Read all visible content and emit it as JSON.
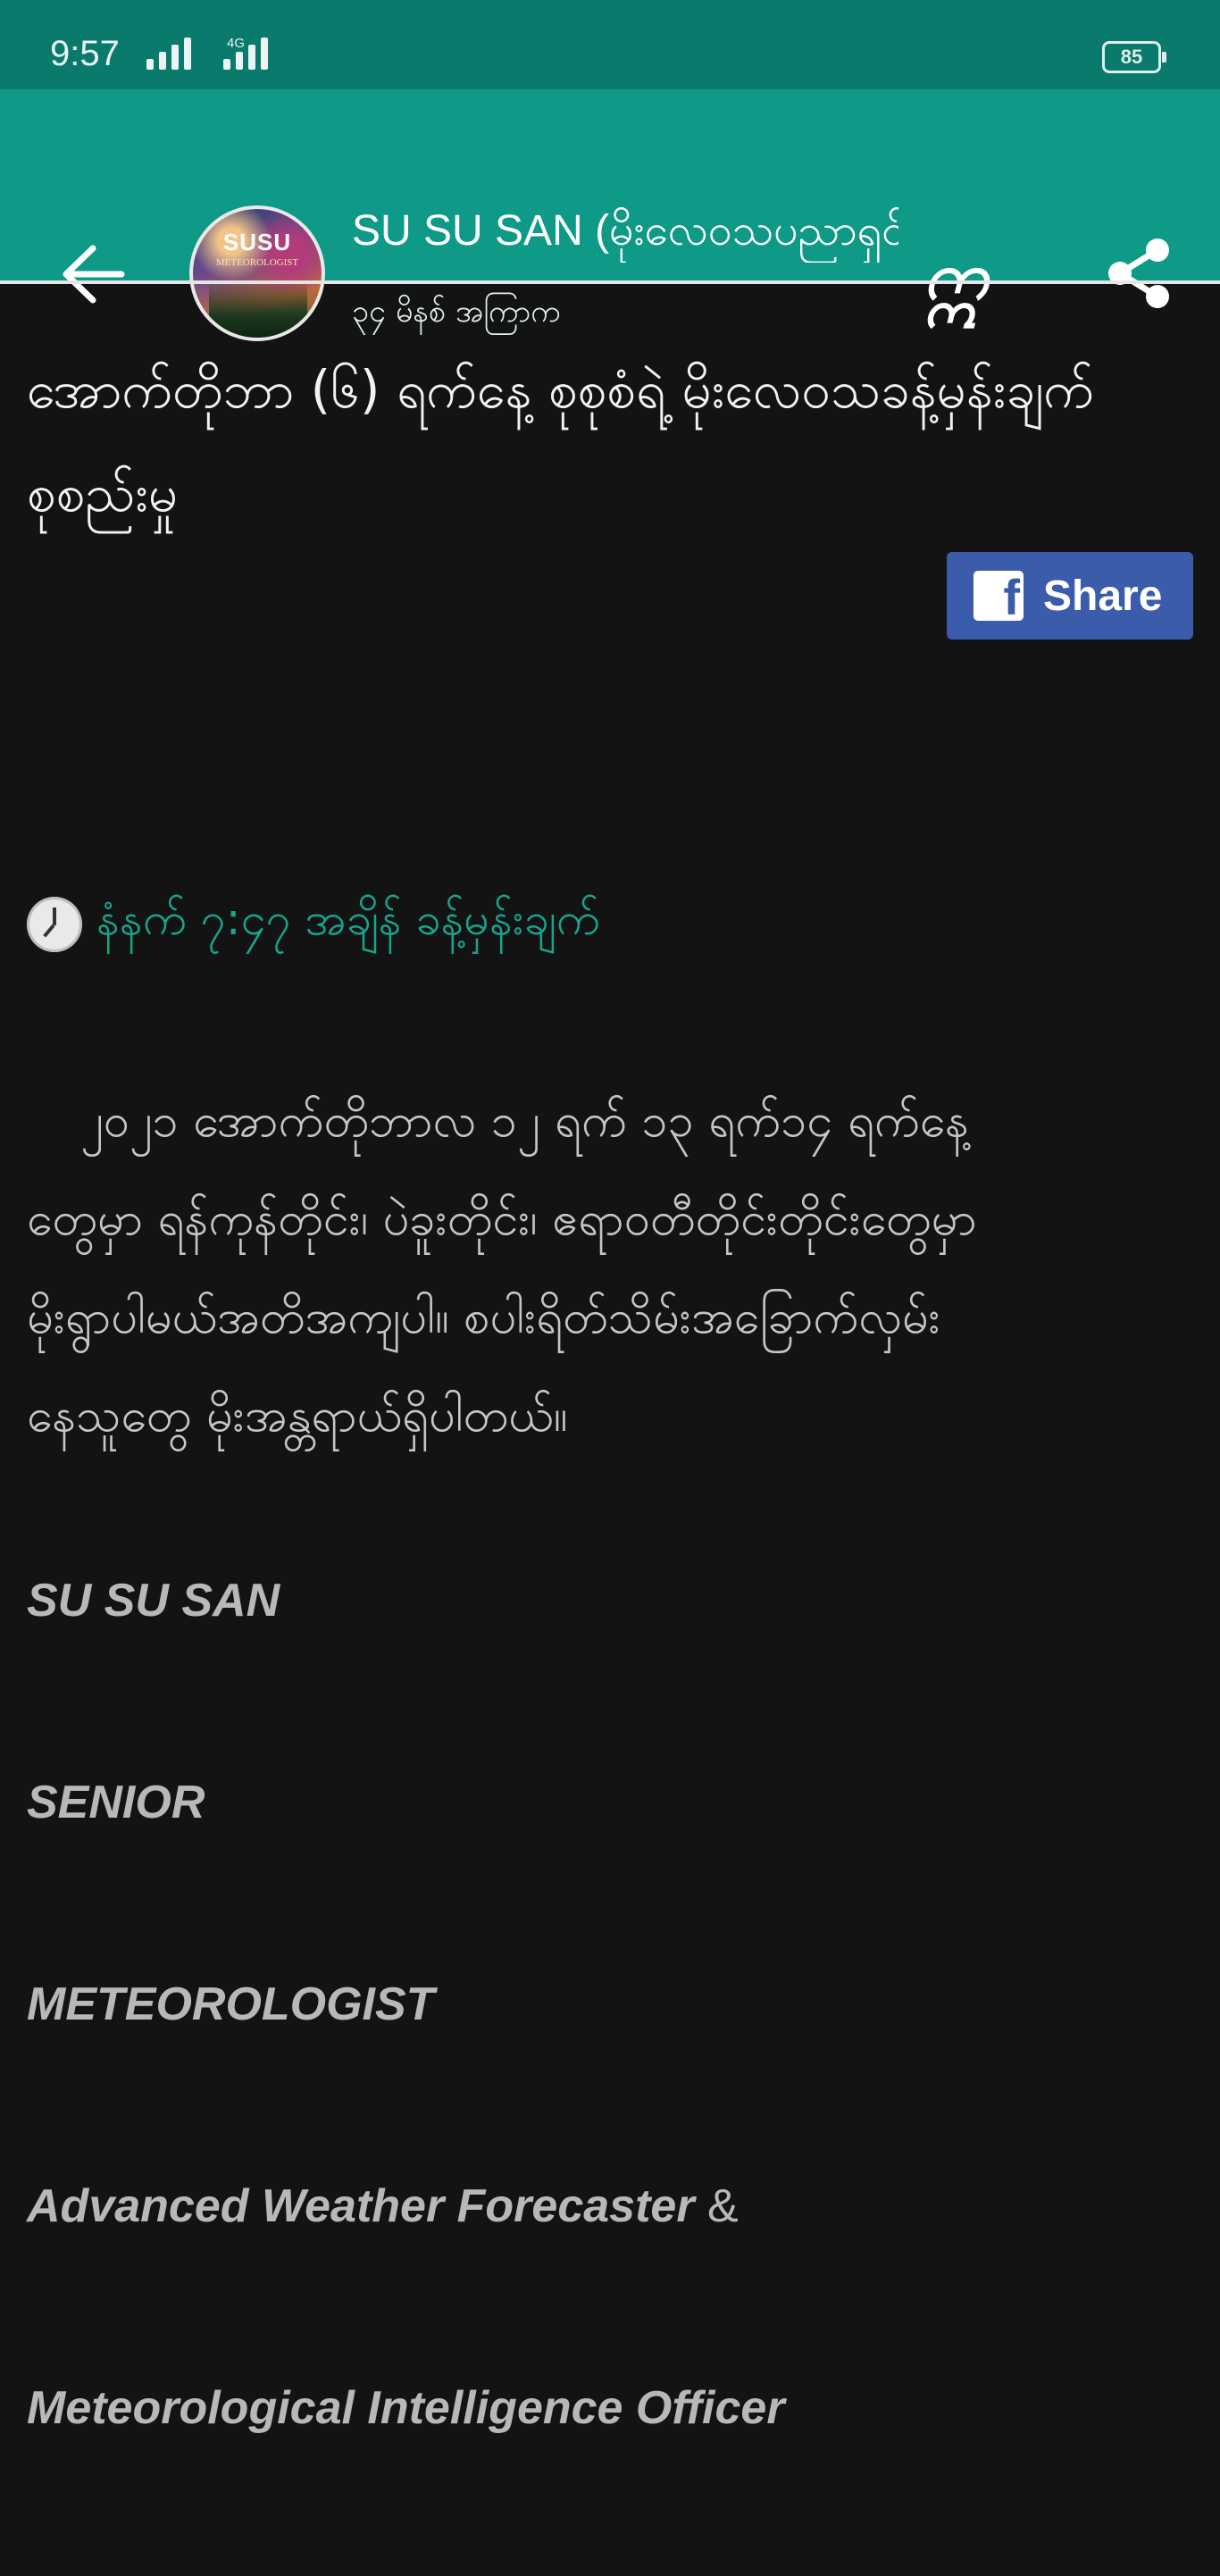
{
  "status_bar": {
    "time": "9:57",
    "network": "4G",
    "battery": "85"
  },
  "app_bar": {
    "page_name": "SU SU SAN (မိုးလေဝသပညာရှင်)",
    "post_time": "၃၄ မိနစ် အကြာက",
    "page_glyph": "ဣ",
    "avatar_text": "SUSU",
    "avatar_subtext": "METEOROLOGIST",
    "icons": [
      "back-arrow-icon",
      "share-icon"
    ]
  },
  "post": {
    "headline": "အောက်တိုဘာ (၆) ရက်နေ့ စုစုစံရဲ့ မိုးလေဝသခန့်မှန်းချက် စုစည်းမှု",
    "share_button_label": "Share",
    "time_line": "နံနက် ၇:၄၇ အချိန် ခန့်မှန်းချက်",
    "body_lines": [
      "၂၀၂၁ အောက်တိုဘာလ ၁၂ ရက် ၁၃ ရက်၁၄ ရက်နေ့",
      "တွေမှာ ရန်ကုန်တိုင်း၊ ပဲခူးတိုင်း၊ ဧရာဝတီတိုင်းတိုင်းတွေမှာ",
      "မိုးရွာပါမယ်အတိအကျပါ။ စပါးရိတ်သိမ်းအခြောက်လှမ်း",
      "နေသူတွေ မိုးအန္တရာယ်ရှိပါတယ်။"
    ],
    "signature": {
      "name": "SU SU SAN",
      "title_1": "SENIOR",
      "title_2": "METEOROLOGIST",
      "title_3": "Advanced Weather Forecaster",
      "ampersand": "&",
      "title_4": "Meteorological Intelligence Officer"
    }
  },
  "colors": {
    "status_bar": "#0a7a6c",
    "app_bar": "#0e9a87",
    "background": "#131313",
    "accent_text": "#18a58e",
    "facebook_blue": "#3b5bab"
  }
}
